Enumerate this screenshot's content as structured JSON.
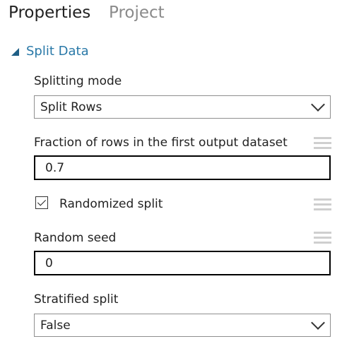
{
  "tabs": {
    "properties": "Properties",
    "project": "Project"
  },
  "section": {
    "title": "Split Data",
    "state": "expanded"
  },
  "fields": {
    "splitting_mode": {
      "label": "Splitting mode",
      "value": "Split Rows"
    },
    "fraction": {
      "label": "Fraction of rows in the first output dataset",
      "value": "0.7"
    },
    "randomized": {
      "label": "Randomized split",
      "checked": true
    },
    "random_seed": {
      "label": "Random seed",
      "value": "0"
    },
    "stratified": {
      "label": "Stratified split",
      "value": "False"
    }
  },
  "icons": {
    "section_toggle": "triangle-expanded-icon",
    "dropdown": "chevron-down-icon",
    "drag_handle": "hamburger-handle-icon",
    "checkbox": "checkmark-icon"
  },
  "colors": {
    "section_title": "#2a79a8",
    "section_arrow": "#1f5f86",
    "active_tab": "#222222",
    "inactive_tab": "#8a8a8a",
    "handle": "#cfcfcf"
  }
}
